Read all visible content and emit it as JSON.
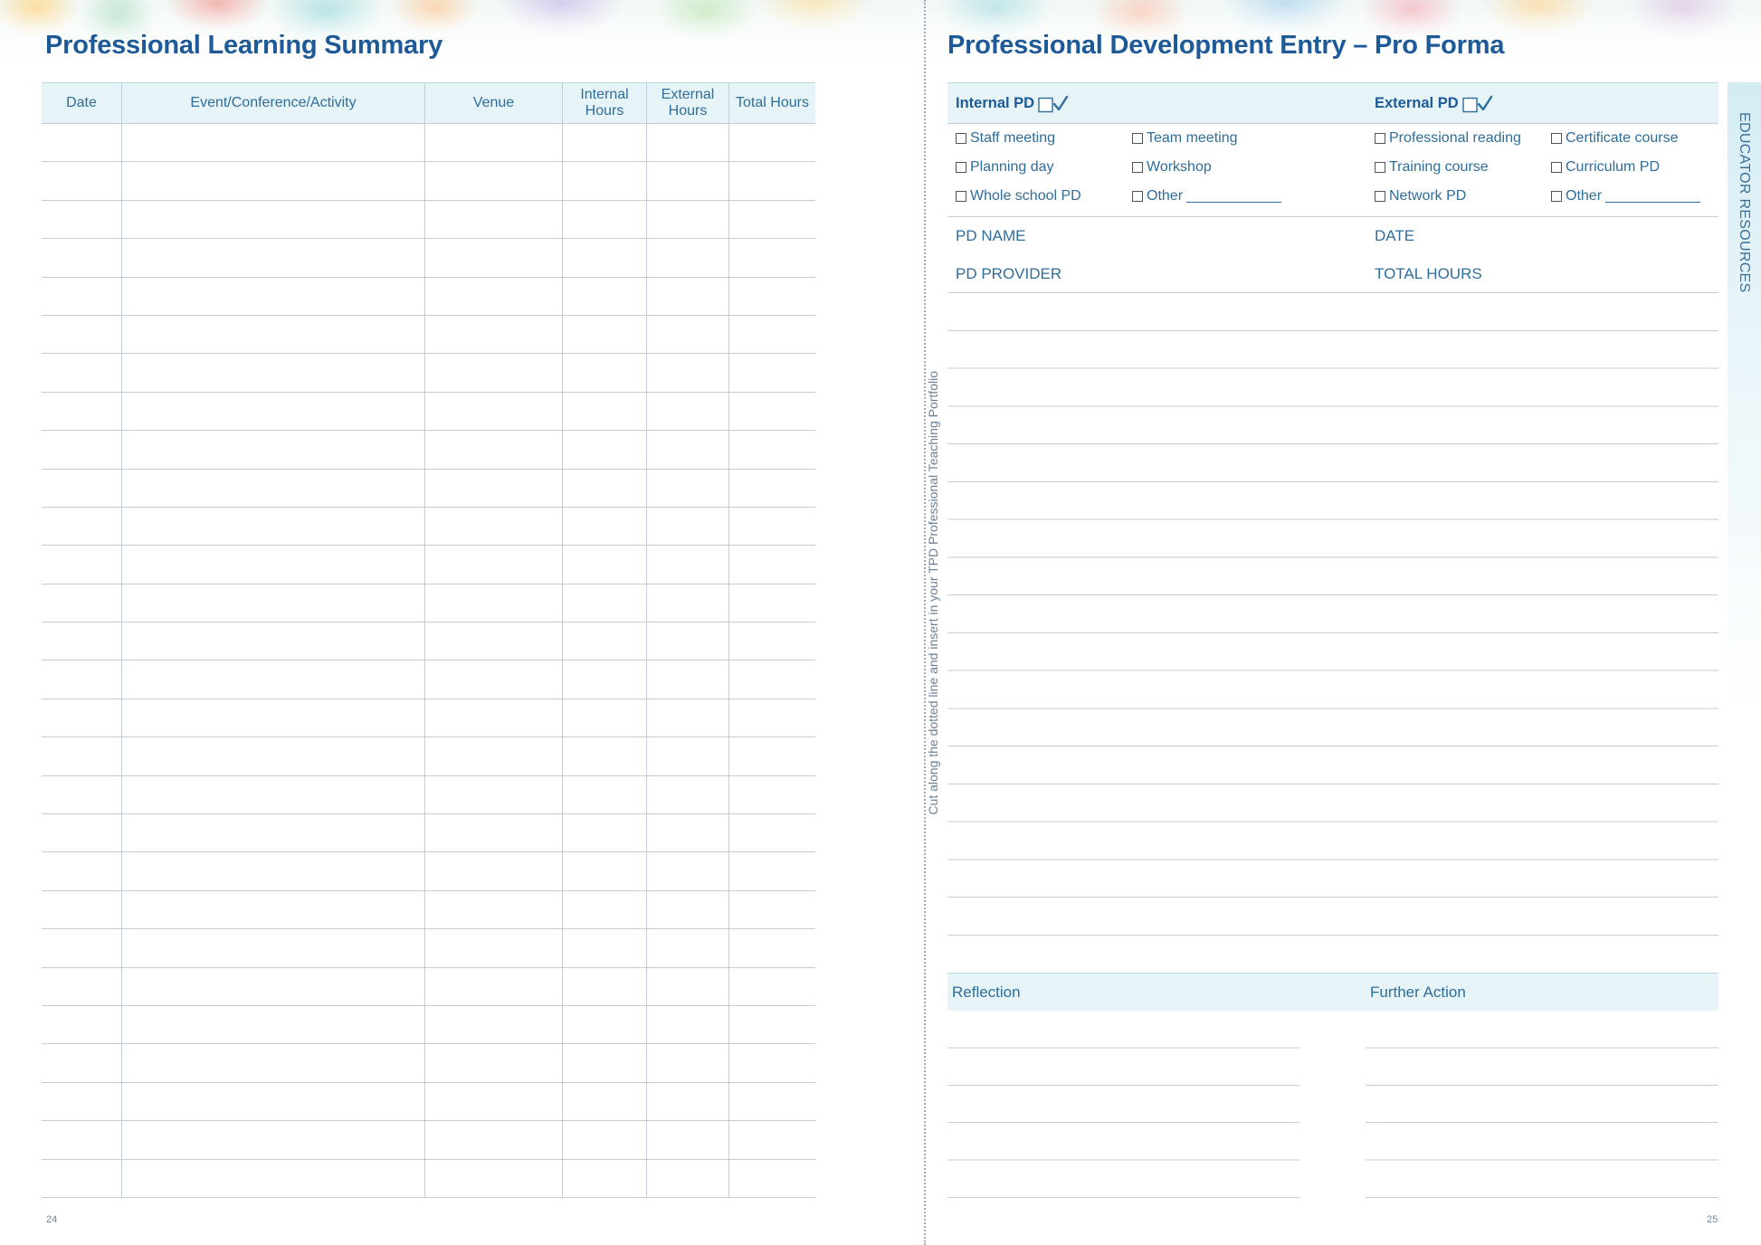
{
  "left_page": {
    "title": "Professional Learning Summary",
    "table": {
      "columns": [
        "Date",
        "Event/Conference/Activity",
        "Venue",
        "Internal Hours",
        "External Hours",
        "Total Hours"
      ]
    },
    "page_number": "24"
  },
  "cut_instruction": "Cut along the dotted line and insert in your TPD Professional Teaching Portfolio",
  "right_page": {
    "title": "Professional Development Entry – Pro Forma",
    "internal": {
      "label": "Internal PD",
      "options": [
        "Staff meeting",
        "Planning day",
        "Whole school PD",
        "Team meeting",
        "Workshop",
        "Other"
      ]
    },
    "external": {
      "label": "External PD",
      "options": [
        "Professional reading",
        "Training course",
        "Network PD",
        "Certificate course",
        "Curriculum PD",
        "Other"
      ]
    },
    "fields": {
      "pd_name": "PD NAME",
      "date": "DATE",
      "pd_provider": "PD PROVIDER",
      "total_hours": "TOTAL HOURS"
    },
    "reflection_label": "Reflection",
    "further_action_label": "Further Action",
    "page_number": "25"
  },
  "side_tab": "EDUCATOR RESOURCES",
  "icons": {
    "tick": "checkbox-tick-icon",
    "checkbox": "checkbox-icon"
  },
  "colors": {
    "heading": "#1d5a97",
    "text": "#2f6d9a",
    "band": "#e6f4f7",
    "rule": "#c4ccd9"
  }
}
